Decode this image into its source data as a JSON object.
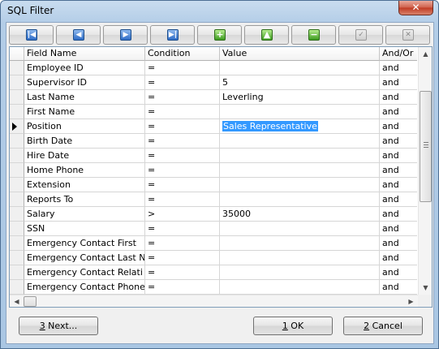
{
  "window": {
    "title": "SQL Filter",
    "close_glyph": "✕"
  },
  "toolbar": {
    "buttons": [
      {
        "name": "first-record",
        "icon": "first-record-icon",
        "glyph": "|◀",
        "enabled": true
      },
      {
        "name": "prior-record",
        "icon": "prior-record-icon",
        "glyph": "◀",
        "enabled": true
      },
      {
        "name": "next-record",
        "icon": "next-record-icon",
        "glyph": "▶",
        "enabled": true
      },
      {
        "name": "last-record",
        "icon": "last-record-icon",
        "glyph": "▶|",
        "enabled": true
      },
      {
        "name": "insert-record",
        "icon": "plus-icon",
        "glyph": "+",
        "enabled": true
      },
      {
        "name": "edit-record",
        "icon": "up-triangle-icon",
        "glyph": "▲",
        "enabled": true
      },
      {
        "name": "delete-record",
        "icon": "minus-icon",
        "glyph": "−",
        "enabled": true
      },
      {
        "name": "post-edit",
        "icon": "checkmark-icon",
        "glyph": "✓",
        "enabled": false
      },
      {
        "name": "cancel-edit",
        "icon": "x-icon",
        "glyph": "✕",
        "enabled": false
      }
    ]
  },
  "grid": {
    "columns": [
      "Field Name",
      "Condition",
      "Value",
      "And/Or"
    ],
    "current_row_index": 4,
    "rows": [
      {
        "field": "Employee ID",
        "condition": "=",
        "value": "",
        "andor": "and"
      },
      {
        "field": "Supervisor ID",
        "condition": "=",
        "value": "5",
        "andor": "and"
      },
      {
        "field": "Last Name",
        "condition": "=",
        "value": "Leverling",
        "andor": "and"
      },
      {
        "field": "First Name",
        "condition": "=",
        "value": "",
        "andor": "and"
      },
      {
        "field": "Position",
        "condition": "=",
        "value": "Sales Representative",
        "andor": "and"
      },
      {
        "field": "Birth Date",
        "condition": "=",
        "value": "",
        "andor": "and"
      },
      {
        "field": "Hire Date",
        "condition": "=",
        "value": "",
        "andor": "and"
      },
      {
        "field": "Home Phone",
        "condition": "=",
        "value": "",
        "andor": "and"
      },
      {
        "field": "Extension",
        "condition": "=",
        "value": "",
        "andor": "and"
      },
      {
        "field": "Reports To",
        "condition": "=",
        "value": "",
        "andor": "and"
      },
      {
        "field": "Salary",
        "condition": ">",
        "value": "35000",
        "andor": "and"
      },
      {
        "field": "SSN",
        "condition": "=",
        "value": "",
        "andor": "and"
      },
      {
        "field": "Emergency Contact First",
        "condition": "=",
        "value": "",
        "andor": "and"
      },
      {
        "field": "Emergency Contact Last N",
        "condition": "=",
        "value": "",
        "andor": "and"
      },
      {
        "field": "Emergency Contact Relati",
        "condition": "=",
        "value": "",
        "andor": "and"
      },
      {
        "field": "Emergency Contact Phone",
        "condition": "=",
        "value": "",
        "andor": "and"
      }
    ]
  },
  "buttons": {
    "next": {
      "accel": "3",
      "rest": " Next..."
    },
    "ok": {
      "accel": "1",
      "rest": " OK"
    },
    "cancel": {
      "accel": "2",
      "rest": " Cancel"
    }
  },
  "scroll_arrows": {
    "up": "▲",
    "down": "▼",
    "left": "◀",
    "right": "▶"
  }
}
